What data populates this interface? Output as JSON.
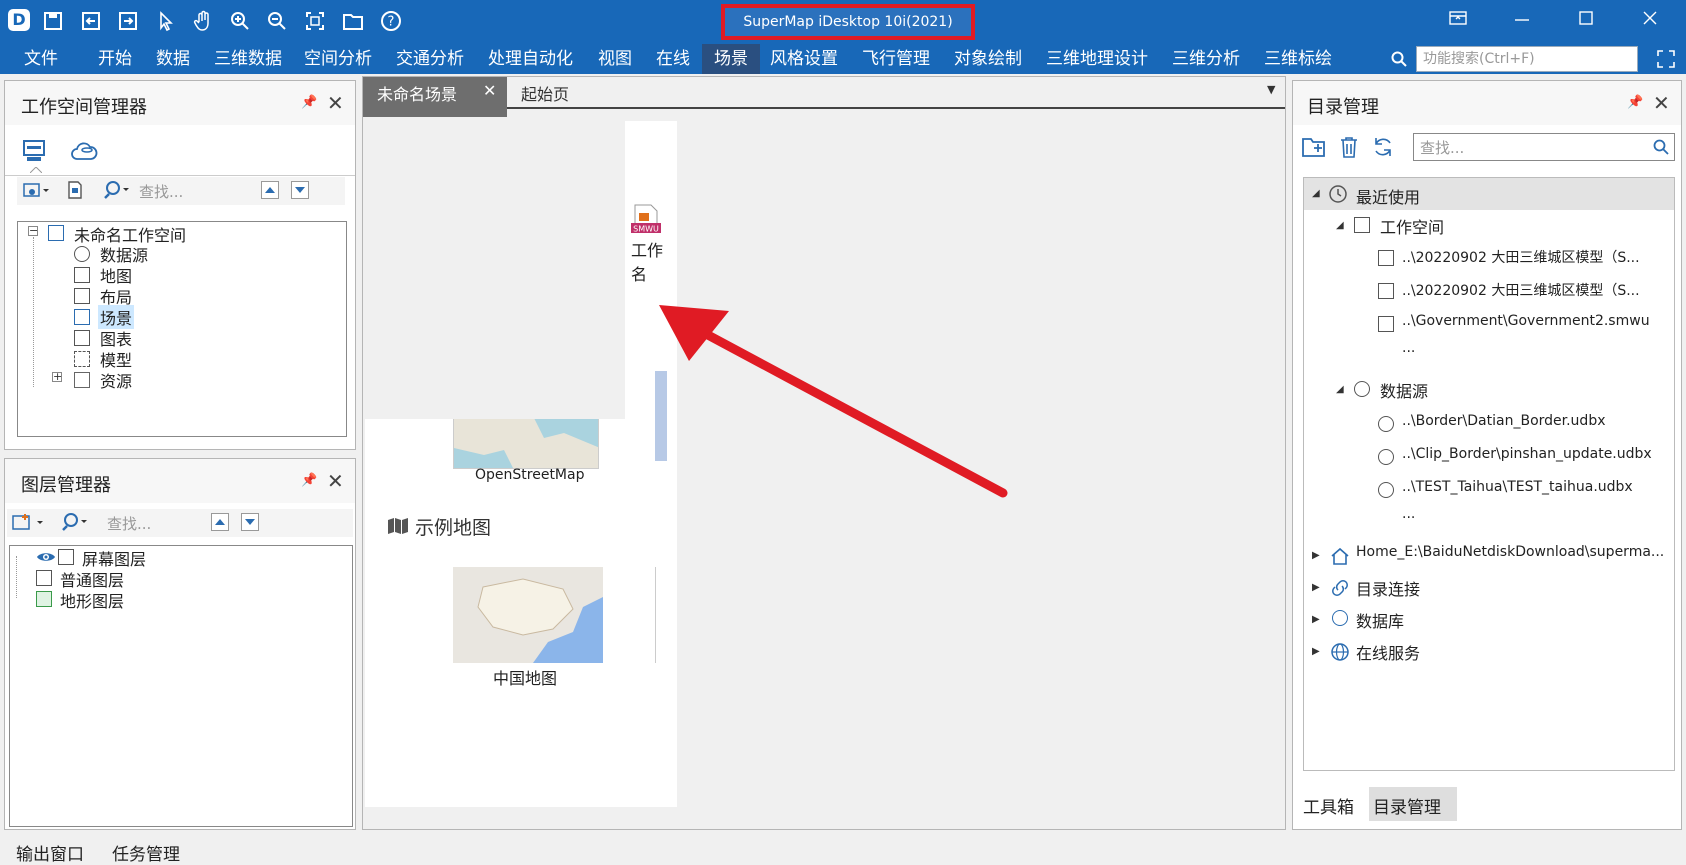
{
  "app": {
    "title": "SuperMap iDesktop 10i(2021)",
    "logo": "D"
  },
  "toolbar_icons": [
    "save-icon",
    "import-icon",
    "export-icon",
    "pointer-icon",
    "pan-hand-icon",
    "zoom-in-icon",
    "zoom-out-icon",
    "full-extent-icon",
    "open-folder-icon",
    "help-icon"
  ],
  "menu": [
    "文件",
    "开始",
    "数据",
    "三维数据",
    "空间分析",
    "交通分析",
    "处理自动化",
    "视图",
    "在线",
    "场景",
    "风格设置",
    "飞行管理",
    "对象绘制",
    "三维地理设计",
    "三维分析",
    "三维标绘"
  ],
  "search": {
    "placeholder": "功能搜索(Ctrl+F)"
  },
  "workspace_panel": {
    "title": "工作空间管理器",
    "search_placeholder": "查找...",
    "root": "未命名工作空间",
    "items": [
      "数据源",
      "地图",
      "布局",
      "场景",
      "图表",
      "模型",
      "资源"
    ],
    "selected": "场景"
  },
  "layer_panel": {
    "title": "图层管理器",
    "search_placeholder": "查找...",
    "items": [
      "屏幕图层",
      "普通图层",
      "地形图层"
    ]
  },
  "doc_tabs": {
    "active": "未命名场景",
    "inactive": "起始页"
  },
  "start_page": {
    "workspace_label": "工作名",
    "smwu_badge": "SMWU",
    "osm_label": "OpenStreetMap",
    "sample_heading": "示例地图",
    "china_label": "中国地图"
  },
  "catalog_panel": {
    "title": "目录管理",
    "search_placeholder": "查找...",
    "recent": "最近使用",
    "workspace_group": "工作空间",
    "workspaces": [
      "..\\20220902 大田三维城区模型（S...",
      "..\\20220902 大田三维城区模型（S...",
      "..\\Government\\Government2.smwu",
      "..."
    ],
    "datasource_group": "数据源",
    "datasources": [
      "..\\Border\\Datian_Border.udbx",
      "..\\Clip_Border\\pinshan_update.udbx",
      "..\\TEST_Taihua\\TEST_taihua.udbx",
      "..."
    ],
    "roots": [
      "Home_E:\\BaiduNetdiskDownload\\superma...",
      "目录连接",
      "数据库",
      "在线服务"
    ]
  },
  "right_tabs": [
    "工具箱",
    "目录管理"
  ],
  "status_tabs": [
    "输出窗口",
    "任务管理"
  ],
  "colors": {
    "title_bar": "#1868b8",
    "highlight": "#e01b24",
    "selection": "#cde8ff"
  }
}
